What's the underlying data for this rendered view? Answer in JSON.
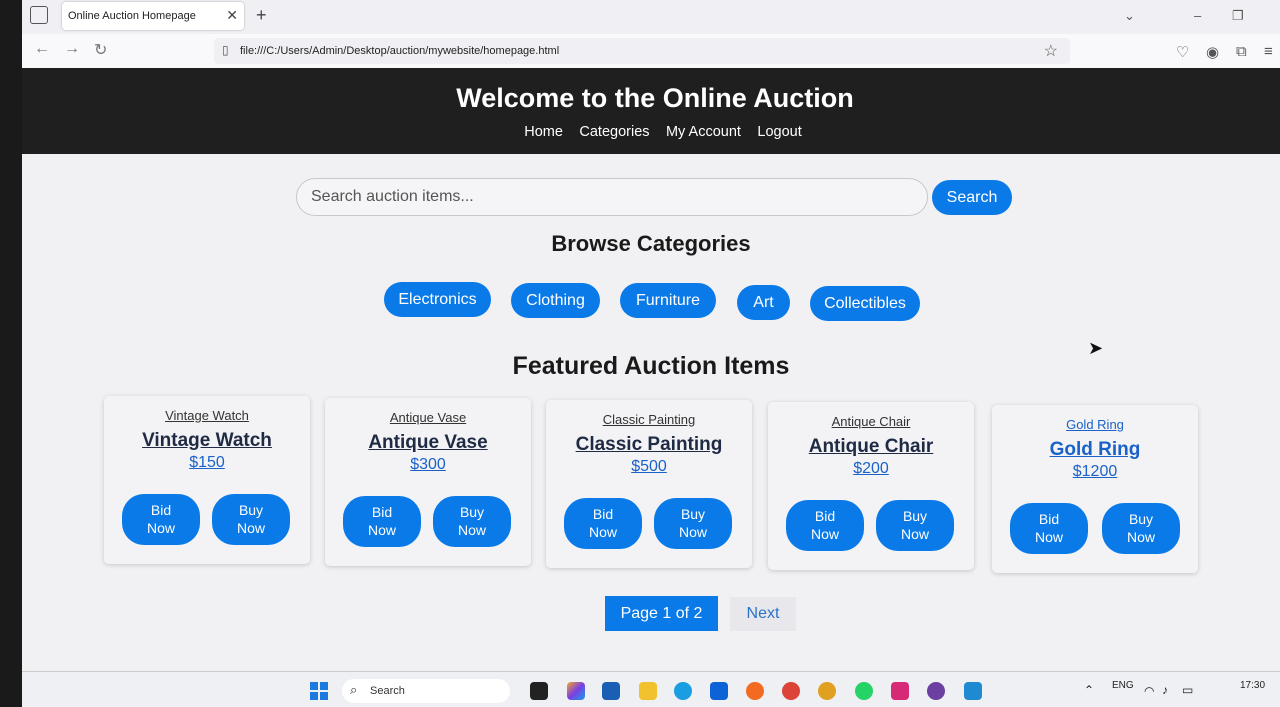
{
  "browser": {
    "tab_title": "Online Auction Homepage",
    "url": "file:///C:/Users/Admin/Desktop/auction/mywebsite/homepage.html"
  },
  "header": {
    "title": "Welcome to the Online Auction",
    "nav": [
      "Home",
      "Categories",
      "My Account",
      "Logout"
    ]
  },
  "search": {
    "placeholder": "Search auction items...",
    "button_label": "Search"
  },
  "categories": {
    "title": "Browse Categories",
    "items": [
      "Electronics",
      "Clothing",
      "Furniture",
      "Art",
      "Collectibles"
    ]
  },
  "featured": {
    "title": "Featured Auction Items",
    "items": [
      {
        "subtitle": "Vintage Watch",
        "name": "Vintage Watch",
        "price": "$150",
        "bid": "Bid Now",
        "buy": "Buy Now"
      },
      {
        "subtitle": "Antique Vase",
        "name": "Antique Vase",
        "price": "$300",
        "bid": "Bid Now",
        "buy": "Buy Now"
      },
      {
        "subtitle": "Classic Painting",
        "name": "Classic Painting",
        "price": "$500",
        "bid": "Bid Now",
        "buy": "Buy Now"
      },
      {
        "subtitle": "Antique Chair",
        "name": "Antique Chair",
        "price": "$200",
        "bid": "Bid Now",
        "buy": "Buy Now"
      },
      {
        "subtitle": "Gold Ring",
        "name": "Gold Ring",
        "price": "$1200",
        "bid": "Bid Now",
        "buy": "Buy Now"
      }
    ]
  },
  "pagination": {
    "current": "Page 1 of 2",
    "next": "Next"
  },
  "taskbar": {
    "search_label": "Search",
    "language": "ENG",
    "time": "17:30"
  },
  "colors": {
    "accent": "#0a7ae8",
    "header_bg": "#1f1f1f"
  }
}
